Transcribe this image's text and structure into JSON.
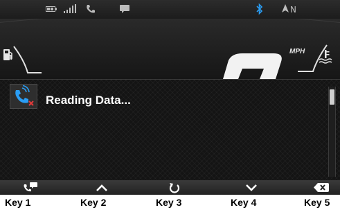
{
  "status_bar": {
    "icons": [
      "battery-icon",
      "signal-bars-icon",
      "phone-icon",
      "message-icon",
      "bluetooth-icon"
    ],
    "compass": "N",
    "bluetooth_color": "#2a9df4"
  },
  "cluster": {
    "speed_unit": "MPH",
    "icons": [
      "fuel-pump-icon",
      "coolant-temp-icon"
    ]
  },
  "panel": {
    "status_icon": "phone-missed-icon",
    "message": "Reading Data...",
    "scroll_position": 0
  },
  "softkeys": [
    {
      "icon": "phone-message-icon"
    },
    {
      "icon": "chevron-up-icon"
    },
    {
      "icon": "refresh-icon"
    },
    {
      "icon": "chevron-down-icon"
    },
    {
      "icon": "backspace-icon"
    }
  ],
  "key_labels": [
    "Key 1",
    "Key 2",
    "Key 3",
    "Key 4",
    "Key 5"
  ]
}
